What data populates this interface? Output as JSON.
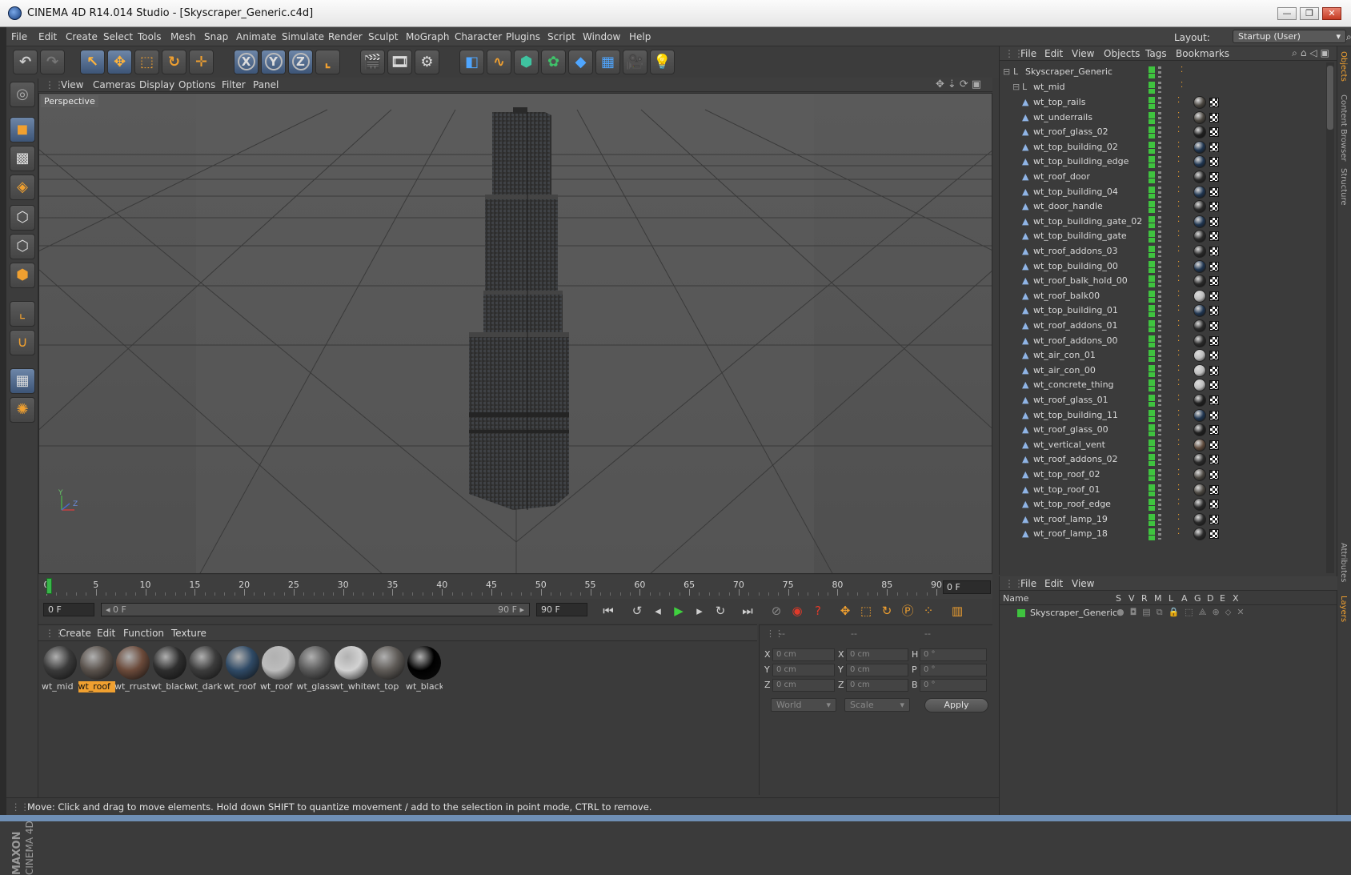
{
  "window": {
    "title": "CINEMA 4D R14.014 Studio - [Skyscraper_Generic.c4d]",
    "minimize": "—",
    "maximize": "❐",
    "close": "✕"
  },
  "menubar": {
    "items": [
      "File",
      "Edit",
      "Create",
      "Select",
      "Tools",
      "Mesh",
      "Snap",
      "Animate",
      "Simulate",
      "Render",
      "Sculpt",
      "MoGraph",
      "Character",
      "Plugins",
      "Script",
      "Window",
      "Help"
    ],
    "layout_label": "Layout:",
    "layout_value": "Startup (User)"
  },
  "toolbar": {
    "icons": [
      "undo-icon",
      "redo-icon",
      "live-selection-icon",
      "move-icon",
      "scale-icon",
      "rotate-icon",
      "transform-icon",
      "x-axis-lock-icon",
      "y-axis-lock-icon",
      "z-axis-lock-icon",
      "coordinate-system-icon",
      "render-view-icon",
      "render-picture-viewer-icon",
      "edit-render-settings-icon",
      "cube-primitive-icon",
      "spline-icon",
      "nurbs-icon",
      "array-icon",
      "deformer-icon",
      "floor-icon",
      "camera-icon",
      "light-icon"
    ],
    "x": "X",
    "y": "Y",
    "z": "Z"
  },
  "viewport": {
    "menu": [
      "View",
      "Cameras",
      "Display",
      "Options",
      "Filter",
      "Panel"
    ],
    "label": "Perspective",
    "axis_y": "Y",
    "axis_z": "Z"
  },
  "timeline": {
    "ticks": [
      "0",
      "5",
      "10",
      "15",
      "20",
      "25",
      "30",
      "35",
      "40",
      "45",
      "50",
      "55",
      "60",
      "65",
      "70",
      "75",
      "80",
      "85",
      "90"
    ],
    "current_frame": "0 F"
  },
  "transport": {
    "start_field": "0 F",
    "range_start": "◂ 0 F",
    "range_end": "90 F ▸",
    "end_field": "90 F"
  },
  "materials": {
    "menu": [
      "Create",
      "Edit",
      "Function",
      "Texture"
    ],
    "items": [
      {
        "label": "wt_mid",
        "color": "#3a3a3a",
        "selected": false
      },
      {
        "label": "wt_roof",
        "color": "#5a524c",
        "selected": true
      },
      {
        "label": "wt_rrust",
        "color": "#6b4a3a",
        "selected": false
      },
      {
        "label": "wt_black",
        "color": "#2e2e2e",
        "selected": false
      },
      {
        "label": "wt_dark",
        "color": "#3c3c3c",
        "selected": false
      },
      {
        "label": "wt_roof",
        "color": "#2f4a66",
        "selected": false
      },
      {
        "label": "wt_roof",
        "color": "#bcbcbc",
        "selected": false
      },
      {
        "label": "wt_glass",
        "color": "#5a5a5a",
        "selected": false
      },
      {
        "label": "wt_white",
        "color": "#d2d2d2",
        "selected": false
      },
      {
        "label": "wt_top",
        "color": "#5e5a56",
        "selected": false
      },
      {
        "label": "wt_black",
        "color": "#000000",
        "selected": false
      }
    ]
  },
  "coordinates": {
    "header_a": "--",
    "header_b": "--",
    "header_c": "--",
    "rows": [
      {
        "l1": "X",
        "v1": "0 cm",
        "l2": "X",
        "v2": "0 cm",
        "l3": "H",
        "v3": "0 °"
      },
      {
        "l1": "Y",
        "v1": "0 cm",
        "l2": "Y",
        "v2": "0 cm",
        "l3": "P",
        "v3": "0 °"
      },
      {
        "l1": "Z",
        "v1": "0 cm",
        "l2": "Z",
        "v2": "0 cm",
        "l3": "B",
        "v3": "0 °"
      }
    ],
    "mode": "World",
    "size_mode": "Scale",
    "apply": "Apply"
  },
  "status": "Move: Click and drag to move elements. Hold down SHIFT to quantize movement / add to the selection in point mode, CTRL to remove.",
  "objects": {
    "menu": [
      "File",
      "Edit",
      "View",
      "Objects",
      "Tags",
      "Bookmarks"
    ],
    "root": "Skyscraper_Generic",
    "group": "wt_mid",
    "items": [
      {
        "name": "wt_top_rails",
        "ball": "#4a4640"
      },
      {
        "name": "wt_underrails",
        "ball": "#4a4640"
      },
      {
        "name": "wt_roof_glass_02",
        "ball": "#202020"
      },
      {
        "name": "wt_top_building_02",
        "ball": "#1f3550"
      },
      {
        "name": "wt_top_building_edge",
        "ball": "#1f3550"
      },
      {
        "name": "wt_roof_door",
        "ball": "#2a2a2a"
      },
      {
        "name": "wt_top_building_04",
        "ball": "#1f3550"
      },
      {
        "name": "wt_door_handle",
        "ball": "#2a2a2a"
      },
      {
        "name": "wt_top_building_gate_02",
        "ball": "#1f3550"
      },
      {
        "name": "wt_top_building_gate",
        "ball": "#2a2a2a"
      },
      {
        "name": "wt_roof_addons_03",
        "ball": "#2a2a2a"
      },
      {
        "name": "wt_top_building_00",
        "ball": "#1f3550"
      },
      {
        "name": "wt_roof_balk_hold_00",
        "ball": "#2a2a2a"
      },
      {
        "name": "wt_roof_balk00",
        "ball": "#bdbdbd"
      },
      {
        "name": "wt_top_building_01",
        "ball": "#1f3550"
      },
      {
        "name": "wt_roof_addons_01",
        "ball": "#2a2a2a"
      },
      {
        "name": "wt_roof_addons_00",
        "ball": "#2a2a2a"
      },
      {
        "name": "wt_air_con_01",
        "ball": "#bdbdbd"
      },
      {
        "name": "wt_air_con_00",
        "ball": "#bdbdbd"
      },
      {
        "name": "wt_concrete_thing",
        "ball": "#bdbdbd"
      },
      {
        "name": "wt_roof_glass_01",
        "ball": "#202020"
      },
      {
        "name": "wt_top_building_11",
        "ball": "#1f3550"
      },
      {
        "name": "wt_roof_glass_00",
        "ball": "#202020"
      },
      {
        "name": "wt_vertical_vent",
        "ball": "#5e4a3c"
      },
      {
        "name": "wt_roof_addons_02",
        "ball": "#2a2a2a"
      },
      {
        "name": "wt_top_roof_02",
        "ball": "#4a4640"
      },
      {
        "name": "wt_top_roof_01",
        "ball": "#4a4640"
      },
      {
        "name": "wt_top_roof_edge",
        "ball": "#2a2a2a"
      },
      {
        "name": "wt_roof_lamp_19",
        "ball": "#2a2a2a"
      },
      {
        "name": "wt_roof_lamp_18",
        "ball": "#2a2a2a"
      }
    ]
  },
  "side_tabs": [
    "Objects",
    "Content Browser",
    "Structure",
    "Attributes",
    "Layers"
  ],
  "layers": {
    "menu": [
      "File",
      "Edit",
      "View"
    ],
    "columns": [
      "Name",
      "S",
      "V",
      "R",
      "M",
      "L",
      "A",
      "G",
      "D",
      "E",
      "X"
    ],
    "row": "Skyscraper_Generic"
  },
  "colors": {
    "accent": "#f0a030",
    "visible_green": "#3fc33f",
    "selection_blue": "#3d5577"
  }
}
